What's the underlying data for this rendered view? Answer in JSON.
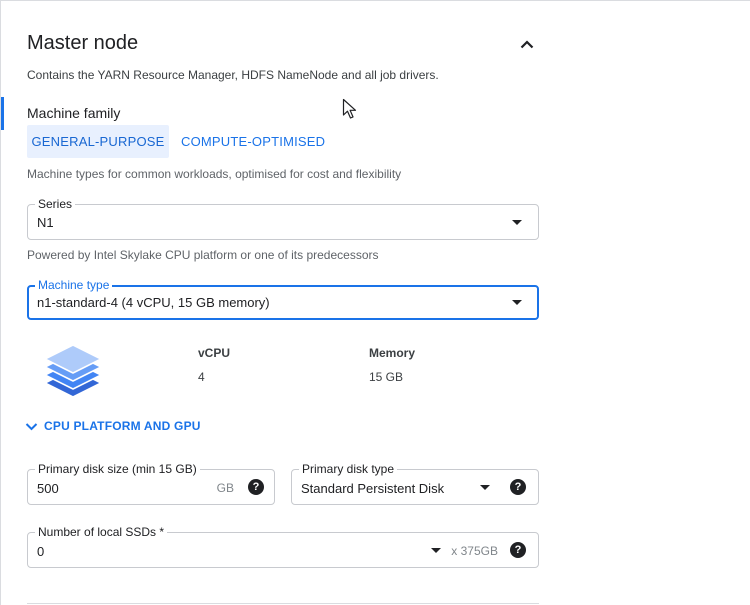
{
  "section": {
    "title": "Master node",
    "description": "Contains the YARN Resource Manager, HDFS NameNode and all job drivers."
  },
  "icons": {
    "collapse": "chevron-up-icon",
    "expand": "chevron-down-icon",
    "help": "help-icon",
    "machine": "stacked-layers-icon",
    "cursor": "mouse-pointer-icon"
  },
  "colors": {
    "accent": "#1a73e8",
    "chip_bg": "#e8f0fe",
    "text": "#202124",
    "muted": "#5f6368"
  },
  "machine_family": {
    "label": "Machine family",
    "options": [
      "GENERAL-PURPOSE",
      "COMPUTE-OPTIMISED"
    ],
    "selected": "GENERAL-PURPOSE",
    "help": "Machine types for common workloads, optimised for cost and flexibility"
  },
  "series": {
    "label": "Series",
    "value": "N1",
    "help": "Powered by Intel Skylake CPU platform or one of its predecessors"
  },
  "machine_type": {
    "label": "Machine type",
    "value": "n1-standard-4 (4 vCPU, 15 GB memory)"
  },
  "specs": {
    "vcpu_label": "vCPU",
    "vcpu_value": "4",
    "memory_label": "Memory",
    "memory_value": "15 GB"
  },
  "cpu_platform_expander": "CPU PLATFORM AND GPU",
  "primary_disk": {
    "label": "Primary disk size (min 15 GB)",
    "value": "500",
    "unit": "GB"
  },
  "primary_disk_type": {
    "label": "Primary disk type",
    "value": "Standard Persistent Disk"
  },
  "local_ssds": {
    "label": "Number of local SSDs *",
    "value": "0",
    "unit": "x 375GB"
  },
  "help_glyph": "?"
}
